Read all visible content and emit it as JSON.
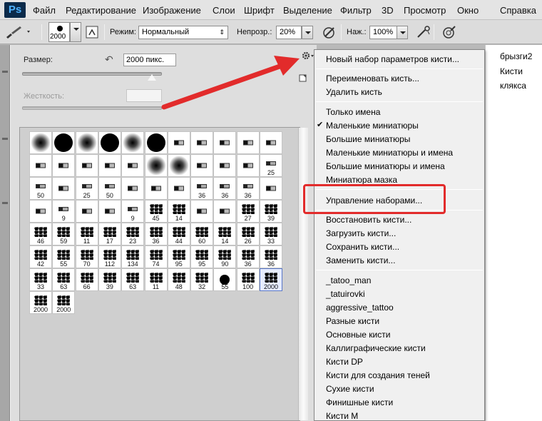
{
  "app": {
    "logo": "Ps",
    "menu": [
      "Файл",
      "Редактирование",
      "Изображение",
      "Слои",
      "Шрифт",
      "Выделение",
      "Фильтр",
      "3D",
      "Просмотр",
      "Окно",
      "Справка"
    ]
  },
  "options_bar": {
    "brush_size": "2000",
    "mode_label": "Режим:",
    "mode_value": "Нормальный",
    "opacity_label": "Непрозр.:",
    "opacity_value": "20%",
    "flow_label": "Наж.:",
    "flow_value": "100%"
  },
  "brush_panel": {
    "size_label": "Размер:",
    "size_value": "2000 пикс.",
    "hardness_label": "Жесткость:",
    "hardness_value": "",
    "size_slider_level": 1.0,
    "hardness_slider_level": 0.0,
    "presets": [
      [
        "",
        "",
        "",
        "",
        "",
        "",
        "",
        "",
        "",
        "",
        ""
      ],
      [
        "",
        "",
        "",
        "",
        "",
        "",
        "",
        "",
        "",
        "",
        "25"
      ],
      [
        "50",
        "",
        "25",
        "50",
        "",
        "",
        "",
        "36",
        "36",
        "36",
        ""
      ],
      [
        "",
        "9",
        "",
        "",
        "9",
        "45",
        "14",
        "",
        "",
        "27",
        "39"
      ],
      [
        "46",
        "59",
        "11",
        "17",
        "23",
        "36",
        "44",
        "60",
        "14",
        "26",
        "33"
      ],
      [
        "42",
        "55",
        "70",
        "112",
        "134",
        "74",
        "95",
        "95",
        "90",
        "36",
        "36"
      ],
      [
        "33",
        "63",
        "66",
        "39",
        "63",
        "11",
        "48",
        "32",
        "55",
        "100",
        "2000"
      ],
      [
        "2000",
        "2000"
      ]
    ]
  },
  "dropdown": {
    "groups": [
      [
        "Новый набор параметров кисти..."
      ],
      [
        "Переименовать кисть...",
        "Удалить кисть"
      ],
      [
        "Только имена",
        "Маленькие миниатюры",
        "Большие миниатюры",
        "Маленькие миниатюры и имена",
        "Большие миниатюры и имена",
        "Миниатюра мазка"
      ],
      [
        "Управление наборами..."
      ],
      [
        "Восстановить кисти...",
        "Загрузить кисти...",
        "Сохранить кисти...",
        "Заменить кисти..."
      ],
      [
        "_tatoo_man",
        "_tatuirovki",
        "aggressive_tattoo",
        "Разные кисти",
        "Основные кисти",
        "Каллиграфические кисти",
        "Кисти DP",
        "Кисти для создания теней",
        "Сухие кисти",
        "Финишные кисти",
        "Кисти М"
      ]
    ],
    "checked_item": "Маленькие миниатюры"
  },
  "right_panel": {
    "items": [
      "брызги2",
      "Кисти",
      "клякса"
    ]
  },
  "colors": {
    "annotation": "#e22b2b",
    "selection_border": "#5a78c8"
  }
}
